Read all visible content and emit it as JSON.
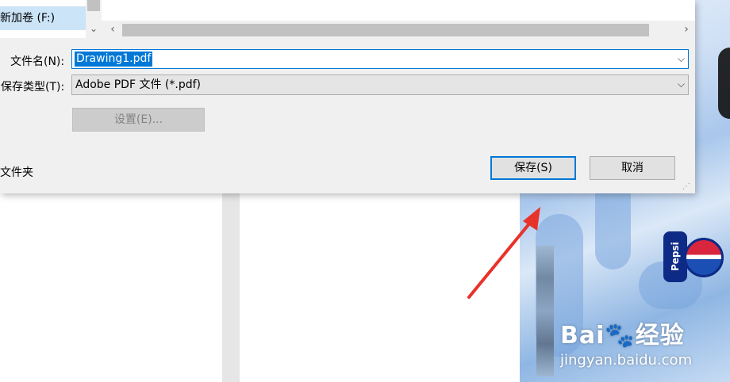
{
  "background": {
    "watermark_brand": "Bai🐾经验",
    "watermark_url": "jingyan.baidu.com",
    "product_text": "Pepsi"
  },
  "nav": {
    "partial_item": "(.)",
    "selected_item": "新加卷 (F:)"
  },
  "scroll": {
    "up_down_glyph": "⌄",
    "left_glyph": "‹",
    "right_glyph": "›"
  },
  "form": {
    "filename_label": "文件名(N):",
    "filename_value": "Drawing1.pdf",
    "filetype_label": "保存类型(T):",
    "filetype_value": "Adobe PDF 文件 (*.pdf)",
    "dropdown_glyph": "⌵",
    "settings_label": "设置(E)..."
  },
  "footer": {
    "hide_folders_label": "文件夹",
    "save_label": "保存(S)",
    "cancel_label": "取消",
    "grip_glyph": "⋰"
  },
  "colors": {
    "accent": "#0078d7",
    "selection": "#cce4f7",
    "dialog_bg": "#f0f0f0",
    "arrow": "#e8332a"
  }
}
